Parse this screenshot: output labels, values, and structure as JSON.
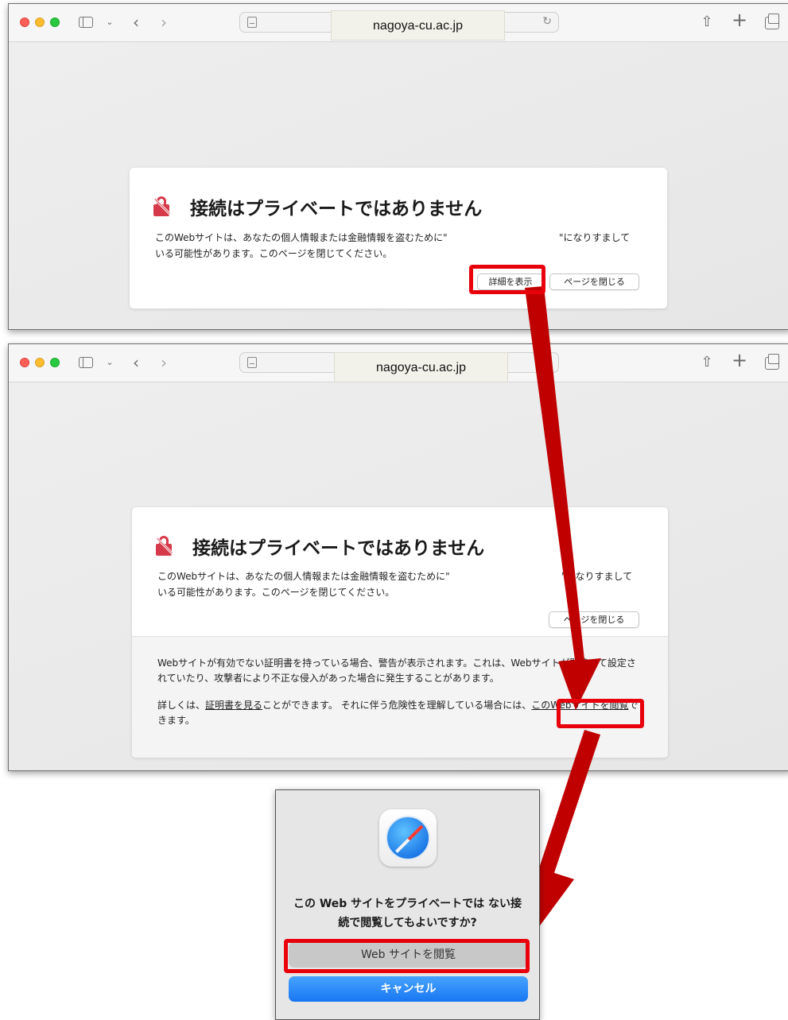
{
  "browser": {
    "domain": "nagoya-cu.ac.jp",
    "icons": [
      "sidebar-icon",
      "chevron-down-icon",
      "back-icon",
      "forward-icon",
      "reload-icon",
      "share-icon",
      "new-tab-icon",
      "tabs-overview-icon"
    ]
  },
  "warning": {
    "title": "接続はプライベートではありません",
    "message_line1": "このWebサイトは、あなたの個人情報または金融情報を盗むために\"",
    "message_line1_tail": "\"になりすまして",
    "message_line2": "いる可能性があります。このページを閉じてください。",
    "show_details_label": "詳細を表示",
    "close_page_label": "ページを閉じる"
  },
  "details": {
    "paragraph1": "Webサイトが有効でない証明書を持っている場合、警告が表示されます。これは、Webサイトが間違って設定されていたり、攻撃者により不正な侵入があった場合に発生することがあります。",
    "p2_before": "詳しくは、",
    "view_certificate_link": "証明書を見る",
    "p2_middle": "ことができます。 それに伴う危険性を理解している場合には、",
    "visit_site_link": "このWebサイトを閲覧",
    "p2_after": "できます。"
  },
  "dialog": {
    "question": "この Web サイトをプライベートでは ない接続で閲覧してもよいですか?",
    "visit_button": "Web サイトを閲覧",
    "cancel_button": "キャンセル"
  },
  "colors": {
    "highlight": "#e8000b",
    "arrow": "#c00000",
    "accent_blue": "#1877f2",
    "warning_red": "#d63a4a"
  }
}
